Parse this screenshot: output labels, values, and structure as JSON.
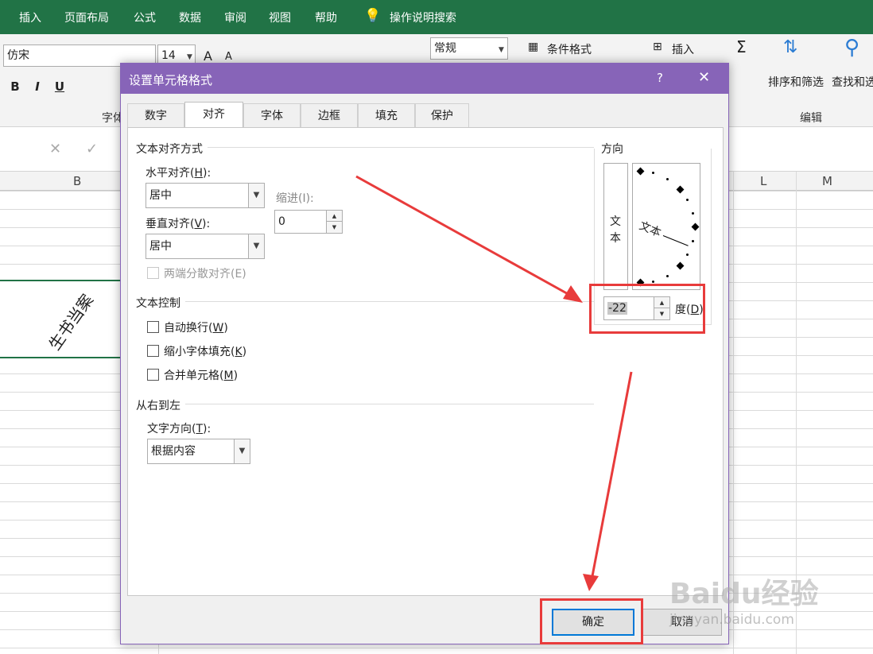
{
  "ribbon": {
    "tabs": [
      "插入",
      "页面布局",
      "公式",
      "数据",
      "审阅",
      "视图",
      "帮助"
    ],
    "tell_me": "操作说明搜索",
    "font_name": "仿宋",
    "font_size": "14",
    "font_group_label": "字体",
    "number_format": "常规",
    "conditional_format": "条件格式",
    "insert": "插入",
    "sort_filter": "排序和筛选",
    "find_select": "查找和选",
    "editing_group_label": "编辑",
    "bold": "B",
    "italic": "I",
    "underline": "U",
    "grow_font": "A",
    "shrink_font": "A",
    "sum_icon": "Σ"
  },
  "sheet": {
    "col_b": "B",
    "col_l": "L",
    "col_m": "M",
    "cell_text": "生书当案",
    "cancel_glyph": "✕",
    "confirm_glyph": "✓"
  },
  "dialog": {
    "title": "设置单元格格式",
    "help": "?",
    "close": "✕",
    "tabs": [
      "数字",
      "对齐",
      "字体",
      "边框",
      "填充",
      "保护"
    ],
    "active_tab": "对齐",
    "text_align_section": "文本对齐方式",
    "horizontal_label": "水平对齐(",
    "horizontal_key": "H",
    "horizontal_label_end": "):",
    "horizontal_value": "居中",
    "vertical_label": "垂直对齐(",
    "vertical_key": "V",
    "vertical_label_end": "):",
    "vertical_value": "居中",
    "indent_label": "缩进(I):",
    "indent_value": "0",
    "justify_distributed": "两端分散对齐(E)",
    "text_control_section": "文本控制",
    "wrap_text": "自动换行(",
    "wrap_key": "W",
    "shrink_to_fit": "缩小字体填充(",
    "shrink_key": "K",
    "merge_cells": "合并单元格(",
    "merge_key": "M",
    "close_paren": ")",
    "rtl_section": "从右到左",
    "text_direction_label": "文字方向(",
    "text_direction_key": "T",
    "text_direction_value": "根据内容",
    "orientation_section": "方向",
    "orientation_vertical_text": [
      "文",
      "本"
    ],
    "orientation_dial_text": "文本",
    "degrees_value": "-22",
    "degrees_label": "度(",
    "degrees_key": "D",
    "ok": "确定",
    "cancel": "取消"
  },
  "watermark": {
    "brand": "Baidu经验",
    "url": "jingyan.baidu.com"
  },
  "colors": {
    "excel_green": "#217346",
    "dialog_purple": "#8764b8",
    "annotation_red": "#e83b3b"
  }
}
